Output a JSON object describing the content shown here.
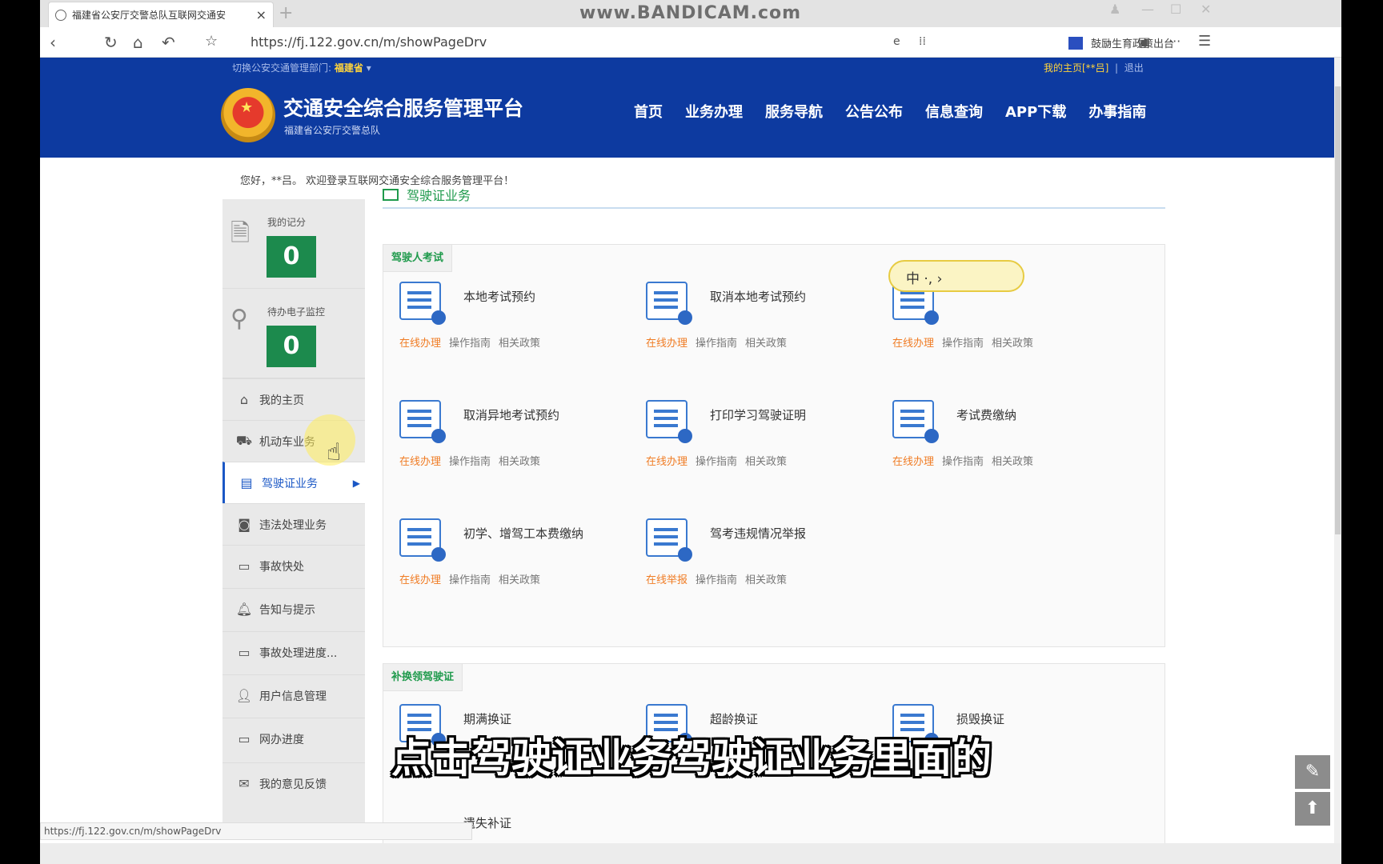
{
  "browser": {
    "tab_title": "福建省公安厅交警总队互联网交通安",
    "tab_close": "×",
    "new_tab": "+",
    "watermark": "www.BANDICAM.com",
    "url": "https://fj.122.gov.cn/m/showPageDrv",
    "extension_label": "鼓励生育政策出台",
    "status_url": "https://fj.122.gov.cn/m/showPageDrv"
  },
  "site": {
    "switch_label": "切换公安交通管理部门:",
    "province": "福建省",
    "my_home": "我的主页[**吕]",
    "logout": "退出",
    "title": "交通安全综合服务管理平台",
    "subtitle": "福建省公安厅交警总队",
    "nav": [
      "首页",
      "业务办理",
      "服务导航",
      "公告公布",
      "信息查询",
      "APP下载",
      "办事指南"
    ]
  },
  "welcome": "您好，**吕。 欢迎登录互联网交通安全综合服务管理平台！",
  "sidebar": {
    "score_label": "我的记分",
    "score_value": "0",
    "monitor_label": "待办电子监控",
    "monitor_value": "0",
    "items": [
      "我的主页",
      "机动车业务",
      "驾驶证业务",
      "违法处理业务",
      "事故快处",
      "告知与提示",
      "事故处理进度...",
      "用户信息管理",
      "网办进度",
      "我的意见反馈"
    ]
  },
  "section_title": "驾驶证业务",
  "panels": {
    "exam_tag": "驾驶人考试",
    "renew_tag": "补换领驾驶证",
    "services": [
      {
        "name": "本地考试预约",
        "action": "在线办理"
      },
      {
        "name": "取消本地考试预约",
        "action": "在线办理"
      },
      {
        "name": "",
        "action": "在线办理"
      },
      {
        "name": "取消异地考试预约",
        "action": "在线办理"
      },
      {
        "name": "打印学习驾驶证明",
        "action": "在线办理"
      },
      {
        "name": "考试费缴纳",
        "action": "在线办理"
      },
      {
        "name": "初学、增驾工本费缴纳",
        "action": "在线办理"
      },
      {
        "name": "驾考违规情况举报",
        "action": "在线举报"
      }
    ],
    "link_guide": "操作指南",
    "link_policy": "相关政策",
    "renew_services": [
      "期满换证",
      "超龄换证",
      "损毁换证",
      "遗失补证"
    ]
  },
  "ime_text": "中 ·, ›",
  "caption": "点击驾驶证业务驾驶证业务里面的"
}
